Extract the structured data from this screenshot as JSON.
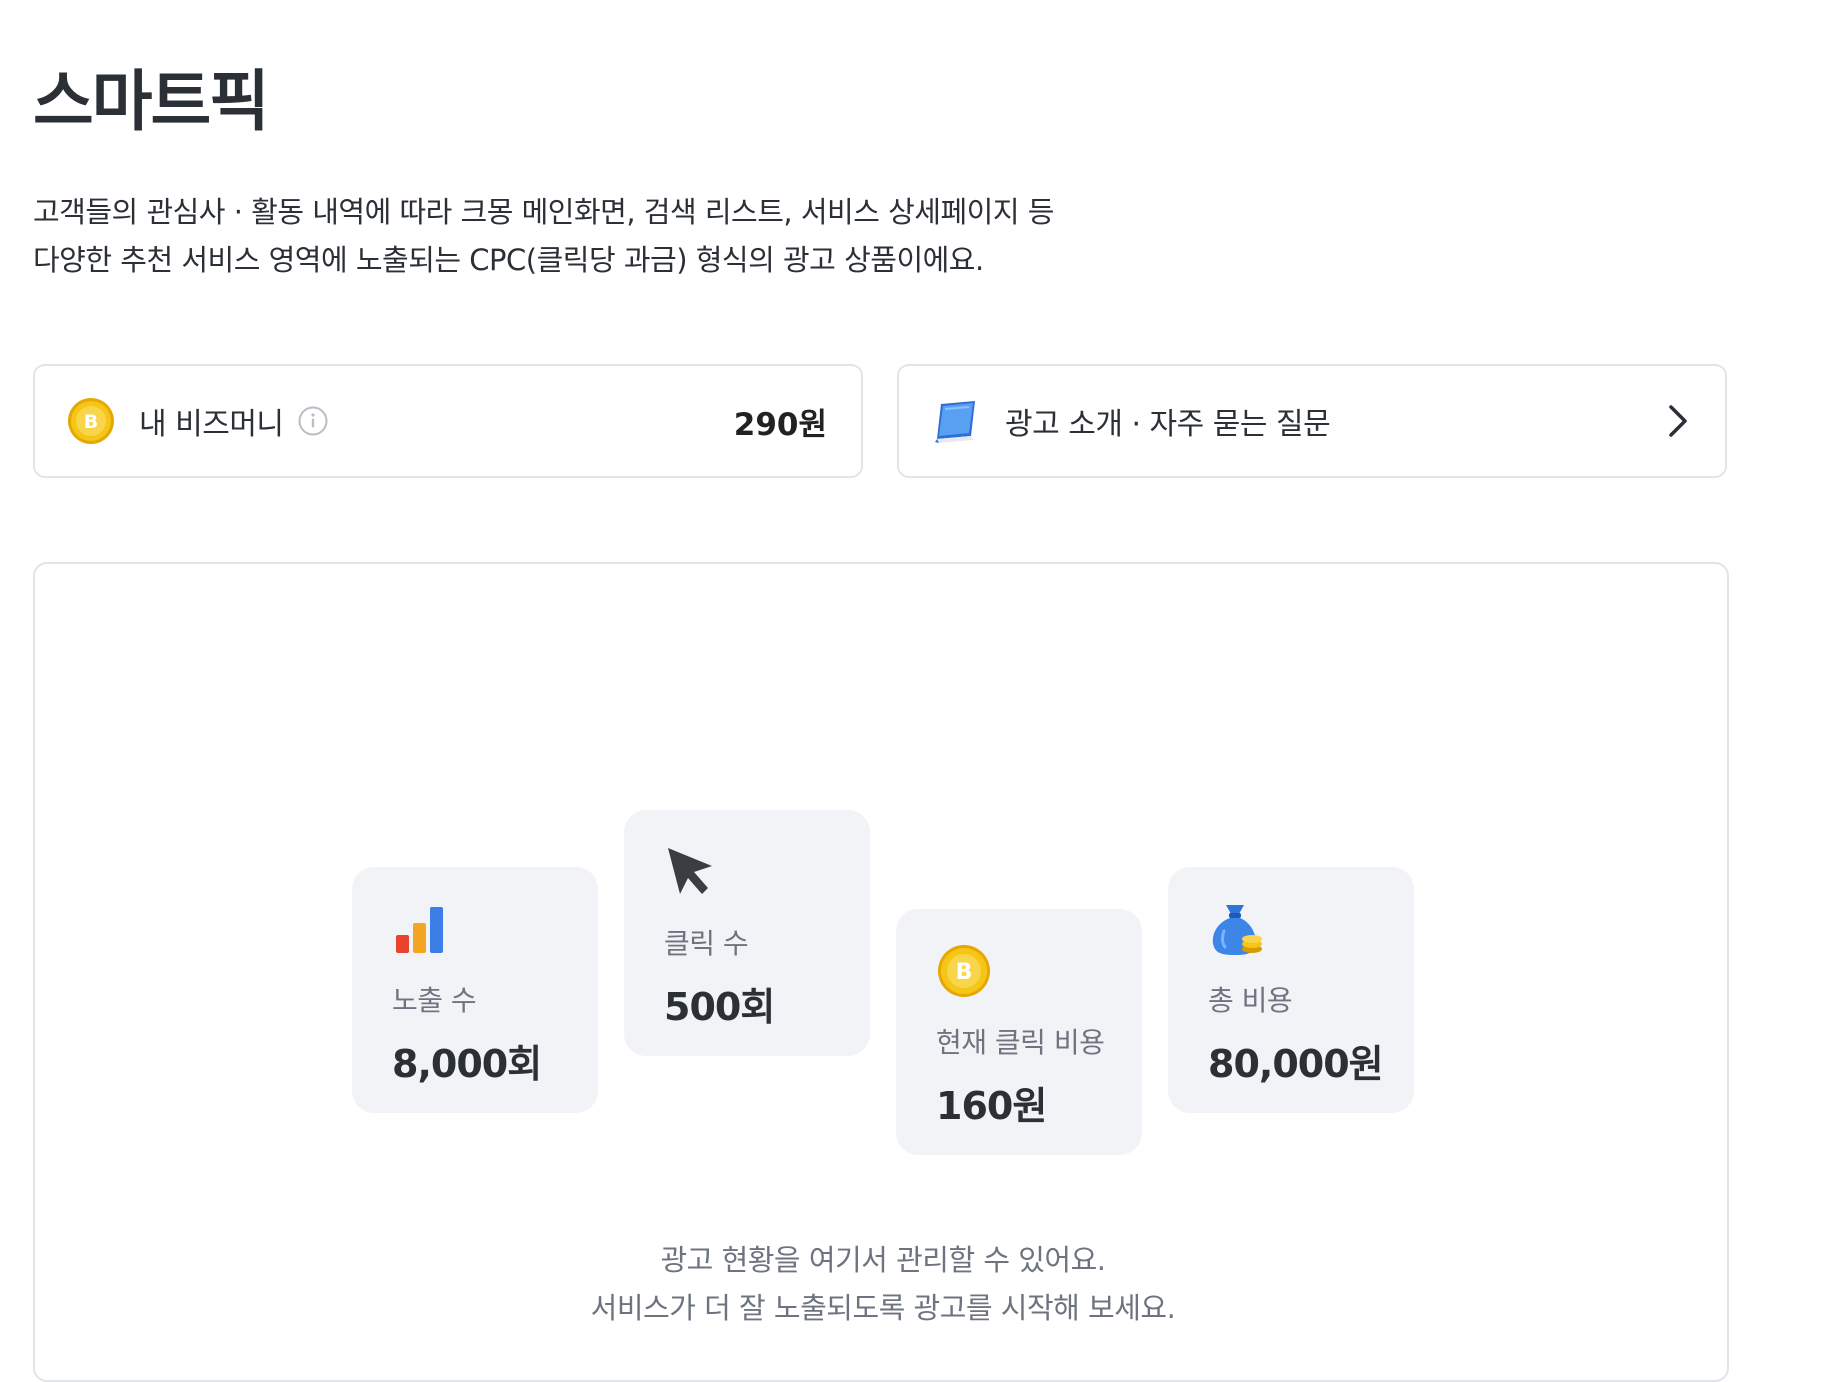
{
  "page": {
    "title": "스마트픽",
    "description_lines": [
      "고객들의 관심사 · 활동 내역에 따라 크몽 메인화면, 검색 리스트, 서비스 상세페이지 등",
      "다양한 추천 서비스 영역에 노출되는 CPC(클릭당 과금) 형식의 광고 상품이에요."
    ]
  },
  "bizmoney_card": {
    "label": "내 비즈머니",
    "value": "290원",
    "icon": "bizmoney-coin-icon",
    "info_icon": "info-icon"
  },
  "faq_card": {
    "label": "광고 소개 · 자주 묻는 질문",
    "icon": "book-icon",
    "arrow_icon": "chevron-right-icon"
  },
  "stats": [
    {
      "icon": "bar-chart-icon",
      "label": "노출 수",
      "value": "8,000회"
    },
    {
      "icon": "cursor-icon",
      "label": "클릭 수",
      "value": "500회"
    },
    {
      "icon": "bizmoney-coin-icon",
      "label": "현재 클릭 비용",
      "value": "160원"
    },
    {
      "icon": "money-bag-icon",
      "label": "총 비용",
      "value": "80,000원"
    }
  ],
  "empty_state": {
    "line1": "광고 현황을 여기서 관리할 수 있어요.",
    "line2": "서비스가 더 잘 노출되도록 광고를 시작해 보세요."
  },
  "colors": {
    "coin": "#F5C518",
    "card_bg": "#F2F3F6",
    "border": "#E2E4E8",
    "muted_text": "#6D7480"
  }
}
